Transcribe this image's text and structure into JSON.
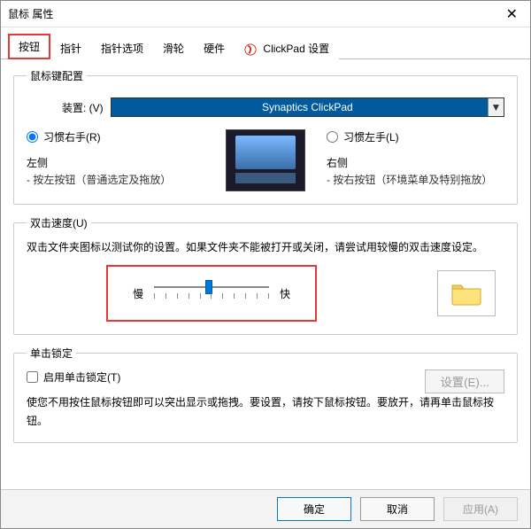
{
  "title": "鼠标 属性",
  "closeGlyph": "✕",
  "tabs": [
    {
      "label": "按钮"
    },
    {
      "label": "指针"
    },
    {
      "label": "指针选项"
    },
    {
      "label": "滑轮"
    },
    {
      "label": "硬件"
    },
    {
      "label": "ClickPad 设置"
    }
  ],
  "config": {
    "legend": "鼠标键配置",
    "deviceLabel": "装置:   (V)",
    "deviceValue": "Synaptics ClickPad",
    "rightHanded": "习惯右手(R)",
    "leftHanded": "习惯左手(L)",
    "leftHead": "左侧",
    "leftDesc": "- 按左按钮（普通选定及拖放）",
    "rightHead": "右侧",
    "rightDesc": "- 按右按钮（环境菜单及特别拖放）"
  },
  "dbl": {
    "legend": "双击速度(U)",
    "help": "双击文件夹图标以测试你的设置。如果文件夹不能被打开或关闭，请尝试用较慢的双击速度设定。",
    "slow": "慢",
    "fast": "快"
  },
  "lock": {
    "legend": "单击锁定",
    "enableLabel": "启用单击锁定(T)",
    "settingsLabel": "设置(E)...",
    "desc": "使您不用按住鼠标按钮即可以突出显示或拖拽。要设置，请按下鼠标按钮。要放开，请再单击鼠标按钮。"
  },
  "footer": {
    "ok": "确定",
    "cancel": "取消",
    "apply": "应用(A)"
  }
}
